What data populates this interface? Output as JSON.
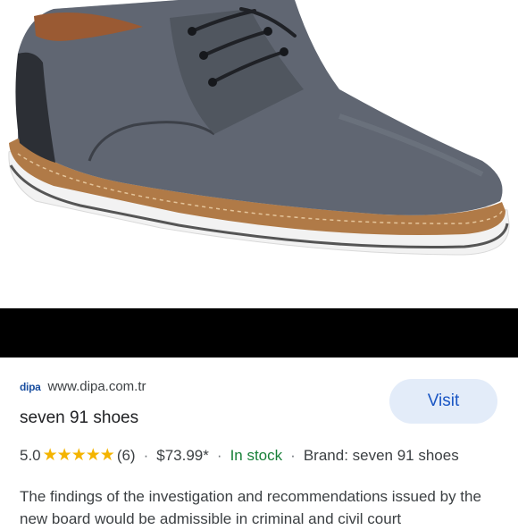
{
  "image": {
    "alt": "Grey linen lace-up derby shoe with brown welt and white sole"
  },
  "source": {
    "favicon_text": "dipa",
    "domain": "www.dipa.com.tr"
  },
  "visit_label": "Visit",
  "product": {
    "title": "seven 91 shoes",
    "rating": "5.0",
    "stars": "★★★★★",
    "review_count": "(6)",
    "price": "$73.99*",
    "stock": "In stock",
    "brand": "Brand: seven 91 shoes",
    "separator": "·"
  },
  "description": "The findings of the investigation and recommendations issued by the new board would be admissible in criminal and civil court",
  "colors": {
    "visit_bg": "#e3ecf9",
    "visit_text": "#1a56c4",
    "star": "#f4b400",
    "in_stock": "#188038"
  }
}
